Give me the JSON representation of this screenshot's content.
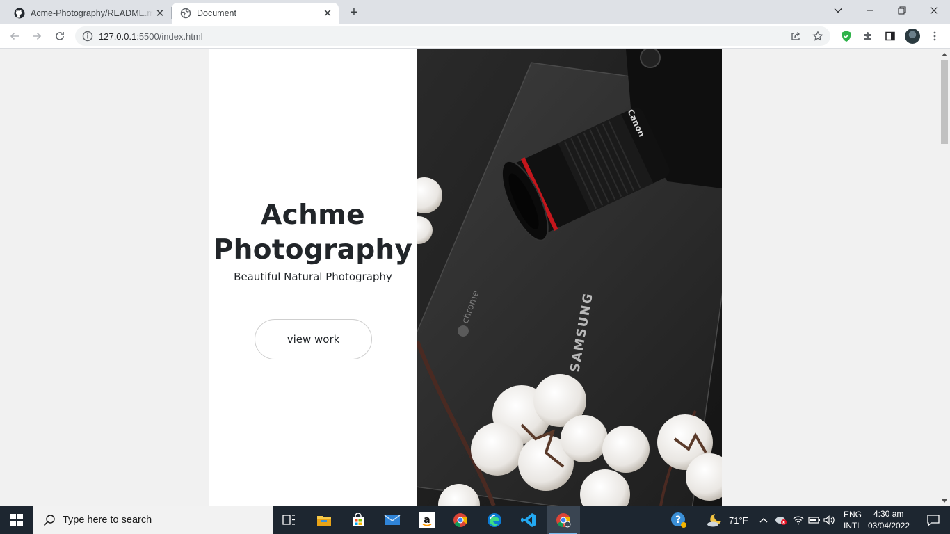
{
  "browser": {
    "tabs": [
      {
        "title": "Acme-Photography/README.md",
        "favicon": "github-icon",
        "active": false
      },
      {
        "title": "Document",
        "favicon": "globe-icon",
        "active": true
      }
    ],
    "address": {
      "host": "127.0.0.1",
      "path": ":5500/index.html"
    }
  },
  "page": {
    "title": "Achme Photography",
    "subtitle": "Beautiful Natural Photography",
    "button_label": "view work",
    "photo_text": {
      "brand": "SAMSUNG",
      "os": "chrome",
      "lens_brand": "Canon"
    }
  },
  "taskbar": {
    "search_placeholder": "Type here to search",
    "apps": [
      "task-view-icon",
      "file-explorer-icon",
      "store-icon",
      "mail-icon",
      "amazon-icon",
      "chrome-icon",
      "edge-icon",
      "vscode-icon",
      "chrome-active-icon"
    ],
    "weather": "71°F",
    "lang_line1": "ENG",
    "lang_line2": "INTL",
    "time": "4:30 am",
    "date": "03/04/2022"
  },
  "colors": {
    "accent": "#76b9ed",
    "page_bg": "#f1f1f1",
    "photo_bg": "#1a1a1a"
  }
}
